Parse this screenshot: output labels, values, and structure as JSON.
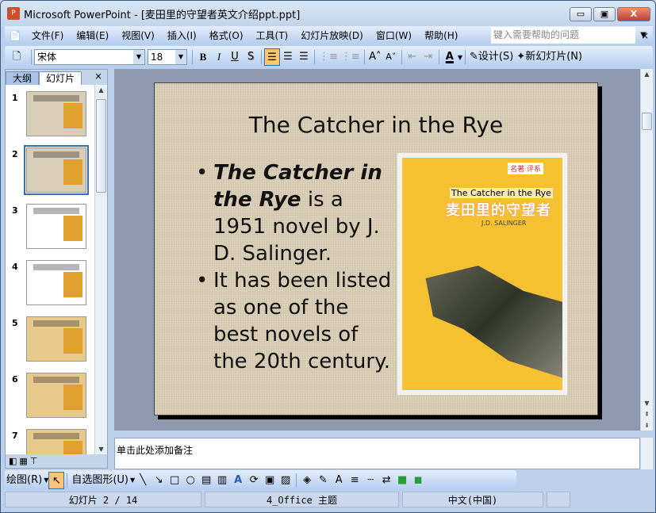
{
  "window": {
    "title": "Microsoft PowerPoint - [麦田里的守望者英文介绍ppt.ppt]",
    "minimize": "▭",
    "restore": "▣",
    "close": "X"
  },
  "menu": {
    "items": [
      "文件(F)",
      "编辑(E)",
      "视图(V)",
      "插入(I)",
      "格式(O)",
      "工具(T)",
      "幻灯片放映(D)",
      "窗口(W)",
      "帮助(H)"
    ],
    "help_placeholder": "键入需要帮助的问题",
    "close": "×"
  },
  "toolbar": {
    "font": "宋体",
    "size": "18",
    "bold": "B",
    "italic": "I",
    "underline": "U",
    "shadow": "S",
    "design": "设计(S)",
    "new_slide": "新幻灯片(N)",
    "font_color": "A"
  },
  "pane": {
    "tabs": [
      "大纲",
      "幻灯片"
    ],
    "close": "×",
    "slides": [
      "1",
      "2",
      "3",
      "4",
      "5",
      "6",
      "7"
    ],
    "selected": 2
  },
  "slide": {
    "title": "The Catcher in the Rye",
    "bullet1_bold": "The Catcher in the Rye",
    "bullet1_rest": " is a 1951 novel by J. D. Salinger.",
    "bullet2": "It has been listed as one of the best novels of the 20th century.",
    "cover": {
      "badge": "名著 评系",
      "en_title": "The Catcher in the Rye",
      "cn_title": "麦田里的守望者",
      "author": "J.D. SALINGER"
    }
  },
  "notes": {
    "placeholder": "单击此处添加备注"
  },
  "drawing": {
    "draw": "绘图(R)",
    "autoshapes": "自选图形(U)"
  },
  "status": {
    "slide": "幻灯片 2 / 14",
    "theme": "4_Office 主题",
    "lang": "中文(中国)"
  },
  "colors": {
    "accent": "#fcc37b",
    "slide_bg": "#d9cdb5",
    "cover": "#f5c132"
  }
}
